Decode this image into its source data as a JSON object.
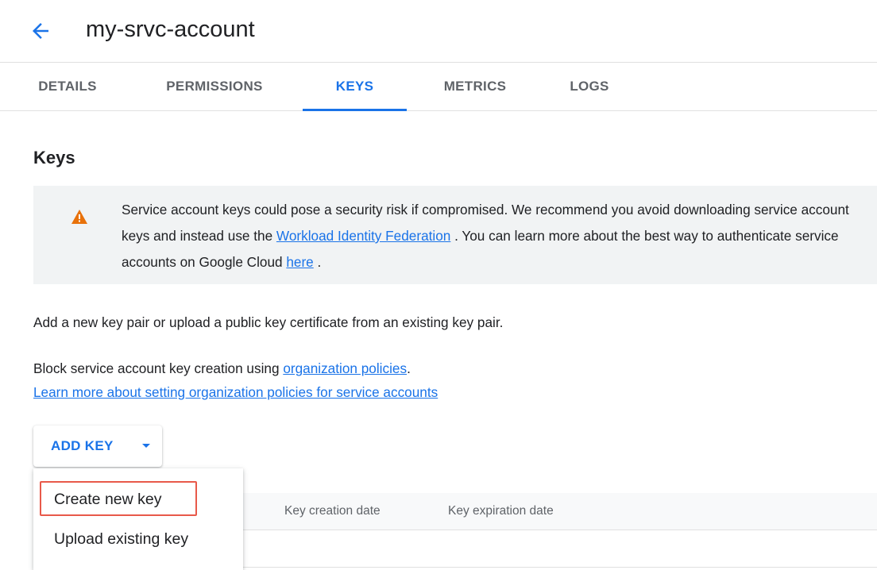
{
  "header": {
    "back_icon": "arrow-back-icon",
    "title": "my-srvc-account"
  },
  "tabs": [
    {
      "label": "DETAILS",
      "active": false
    },
    {
      "label": "PERMISSIONS",
      "active": false
    },
    {
      "label": "KEYS",
      "active": true
    },
    {
      "label": "METRICS",
      "active": false
    },
    {
      "label": "LOGS",
      "active": false
    }
  ],
  "section": {
    "title": "Keys"
  },
  "warning": {
    "icon": "warning-icon",
    "text_1": "Service account keys could pose a security risk if compromised. We recommend you avoid downloading service account keys and instead use the ",
    "link_1": "Workload Identity Federation",
    "text_2": " . You can learn more about the best way to authenticate service accounts on Google Cloud ",
    "link_2": "here",
    "text_3": " ."
  },
  "info": {
    "add_text": "Add a new key pair or upload a public key certificate from an existing key pair.",
    "block_text": "Block service account key creation using ",
    "org_link": "organization policies",
    "block_end": ".",
    "learn_more_link": "Learn more about setting organization policies for service accounts"
  },
  "add_key": {
    "label": "ADD KEY",
    "icon": "caret-down-icon"
  },
  "menu": {
    "items": [
      {
        "label": "Create new key",
        "highlighted": true
      },
      {
        "label": "Upload existing key",
        "highlighted": false
      }
    ]
  },
  "table": {
    "columns": [
      "Key creation date",
      "Key expiration date"
    ]
  },
  "colors": {
    "accent": "#1a73e8",
    "warning": "#e8710a",
    "highlight_border": "#e8594a"
  }
}
